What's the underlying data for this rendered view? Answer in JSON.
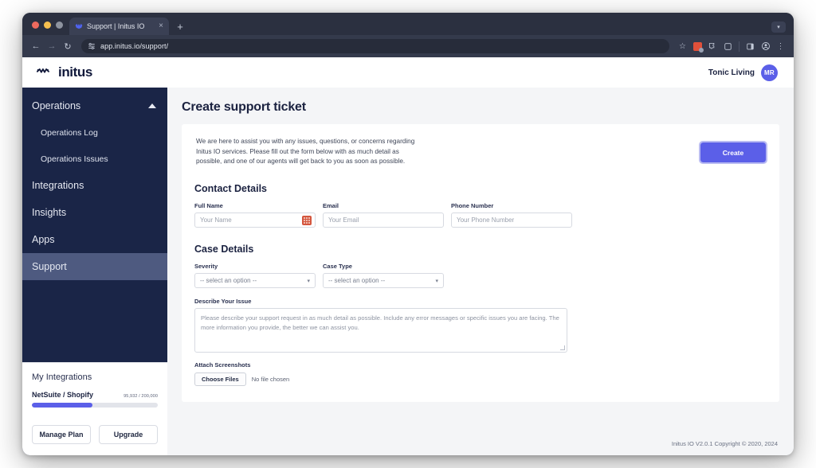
{
  "browser": {
    "tab": {
      "title": "Support | Initus IO",
      "favicon": "initus-favicon",
      "close": "×"
    },
    "new_tab_label": "+",
    "window_menu_caret": "▾",
    "nav": {
      "back": "←",
      "forward": "→",
      "reload": "↻"
    },
    "url": "app.initus.io/support/",
    "url_icon": "site-settings-icon",
    "toolbar_icons": [
      "bookmark-star-icon",
      "extension-badge-icon",
      "extensions-puzzle-icon",
      "split-screen-icon",
      "side-panel-icon",
      "profile-icon",
      "chrome-menu-icon"
    ]
  },
  "header": {
    "logo_text": "initus",
    "org_name": "Tonic Living",
    "avatar_initials": "MR"
  },
  "sidebar": {
    "items": [
      {
        "label": "Operations",
        "type": "group",
        "expanded": true,
        "caret": "caret-up-icon"
      },
      {
        "label": "Operations Log",
        "type": "sub"
      },
      {
        "label": "Operations Issues",
        "type": "sub"
      },
      {
        "label": "Integrations",
        "type": "item"
      },
      {
        "label": "Insights",
        "type": "item"
      },
      {
        "label": "Apps",
        "type": "item"
      },
      {
        "label": "Support",
        "type": "item",
        "active": true
      }
    ],
    "integrations": {
      "title": "My Integrations",
      "name": "NetSuite / Shopify",
      "usage": "95,932 / 200,000",
      "percent": 48,
      "manage_plan": "Manage Plan",
      "upgrade": "Upgrade"
    }
  },
  "main": {
    "page_title": "Create support ticket",
    "intro": "We are here to assist you with any issues, questions, or concerns regarding Initus IO services. Please fill out the form below with as much detail as possible, and one of our agents will get back to you as soon as possible.",
    "create_button": "Create",
    "contact_section": "Contact Details",
    "fields": {
      "full_name": {
        "label": "Full Name",
        "placeholder": "Your Name",
        "value": "",
        "autofill_icon": "autofill-icon"
      },
      "email": {
        "label": "Email",
        "placeholder": "Your Email",
        "value": ""
      },
      "phone": {
        "label": "Phone Number",
        "placeholder": "Your Phone Number",
        "value": ""
      }
    },
    "case_section": "Case Details",
    "selects": {
      "severity": {
        "label": "Severity",
        "selected": "-- select an option --"
      },
      "case_type": {
        "label": "Case Type",
        "selected": "-- select an option --"
      }
    },
    "describe": {
      "label": "Describe Your Issue",
      "placeholder": "Please describe your support request in as much detail as possible. Include any error messages or specific issues you are facing. The more information you provide, the better we can assist you.",
      "value": ""
    },
    "attach": {
      "label": "Attach Screenshots",
      "button": "Choose Files",
      "status": "No file chosen"
    },
    "footer": "Initus IO V2.0.1 Copyright © 2020, 2024"
  },
  "colors": {
    "accent": "#5b5fe8",
    "sidebar": "#1a2547",
    "active_nav": "#4e5a80",
    "page_bg": "#f4f5f7"
  }
}
